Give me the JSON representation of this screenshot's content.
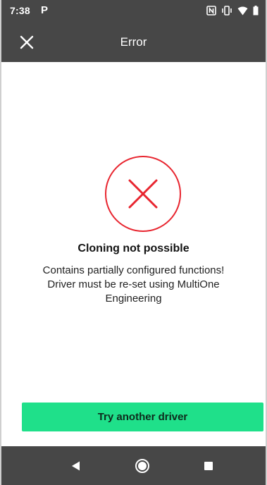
{
  "status_bar": {
    "time": "7:38",
    "notification": "P",
    "icons": [
      "nfc-icon",
      "vibrate-icon",
      "wifi-icon",
      "battery-icon"
    ]
  },
  "app_bar": {
    "title": "Error",
    "close_icon": "close-icon"
  },
  "error": {
    "icon": "error-x-circle-icon",
    "title": "Cloning not possible",
    "message_lines": [
      "Contains partially configured functions!",
      "Driver must be re-set using MultiOne",
      "Engineering"
    ]
  },
  "actions": {
    "primary_label": "Try another driver"
  },
  "nav_bar": {
    "icons": [
      "back-icon",
      "home-icon",
      "recents-icon"
    ]
  },
  "colors": {
    "bar_background": "#474747",
    "error_red": "#e8252f",
    "primary_green": "#1fe08a"
  }
}
